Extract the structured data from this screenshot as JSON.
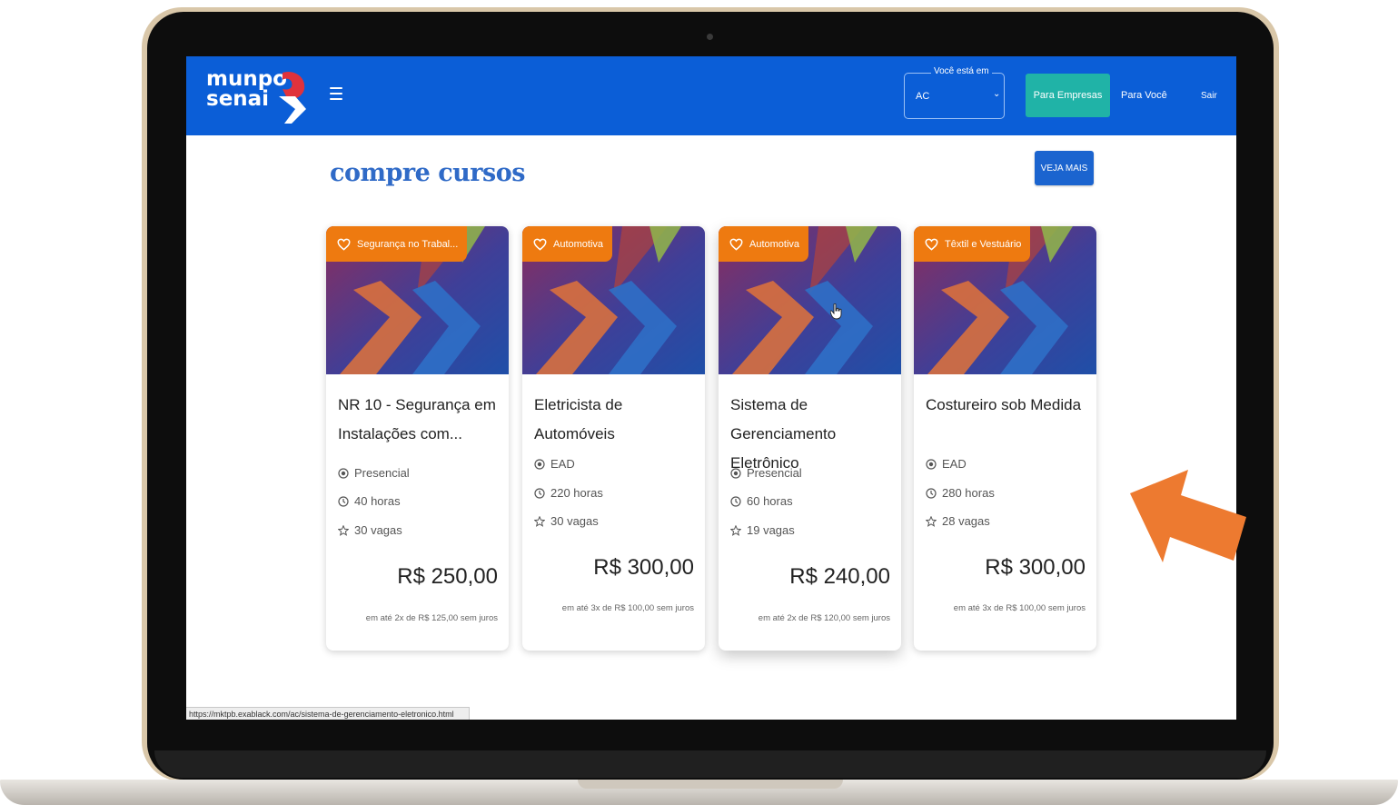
{
  "navbar": {
    "logo_line1": "munpo",
    "logo_line2": "senai",
    "location_label": "Você está em",
    "location_value": "AC",
    "btn_empresas": "Para Empresas",
    "link_voce": "Para Você",
    "link_sair": "Sair"
  },
  "section": {
    "title": "compre cursos",
    "see_more": "VEJA MAIS"
  },
  "cards": [
    {
      "category": "Segurança no Trabal...",
      "title": "NR 10 - Segurança em Instalações com...",
      "modality": "Presencial",
      "hours": "40 horas",
      "seats": "30 vagas",
      "price": "R$ 250,00",
      "installments": "em até 2x de R$ 125,00 sem juros"
    },
    {
      "category": "Automotiva",
      "title": "Eletricista de Automóveis",
      "modality": "EAD",
      "hours": "220 horas",
      "seats": "30 vagas",
      "price": "R$ 300,00",
      "installments": "em até 3x de R$ 100,00 sem juros"
    },
    {
      "category": "Automotiva",
      "title": "Sistema de Gerenciamento Eletrônico",
      "modality": "Presencial",
      "hours": "60 horas",
      "seats": "19 vagas",
      "price": "R$ 240,00",
      "installments": "em até 2x de R$ 120,00 sem juros"
    },
    {
      "category": "Têxtil e Vestuário",
      "title": "Costureiro sob Medida",
      "modality": "EAD",
      "hours": "280 horas",
      "seats": "28 vagas",
      "price": "R$ 300,00",
      "installments": "em até 3x de R$ 100,00 sem juros"
    }
  ],
  "status_bar": {
    "url": "https://mktpb.exablack.com/ac/sistema-de-gerenciamento-eletronico.html"
  },
  "colors": {
    "navbar": "#0b5ed7",
    "teal_button": "#20b3a7",
    "badge": "#ee7a10",
    "title": "#2f6ac7",
    "arrow": "#ed7a30"
  },
  "icons": {
    "menu": "hamburger-icon",
    "badge": "heart-icon",
    "modality": "location-target-icon",
    "hours": "clock-icon",
    "seats": "star-outline-icon",
    "cursor": "hand-pointer-icon",
    "annotation": "arrow-icon"
  }
}
